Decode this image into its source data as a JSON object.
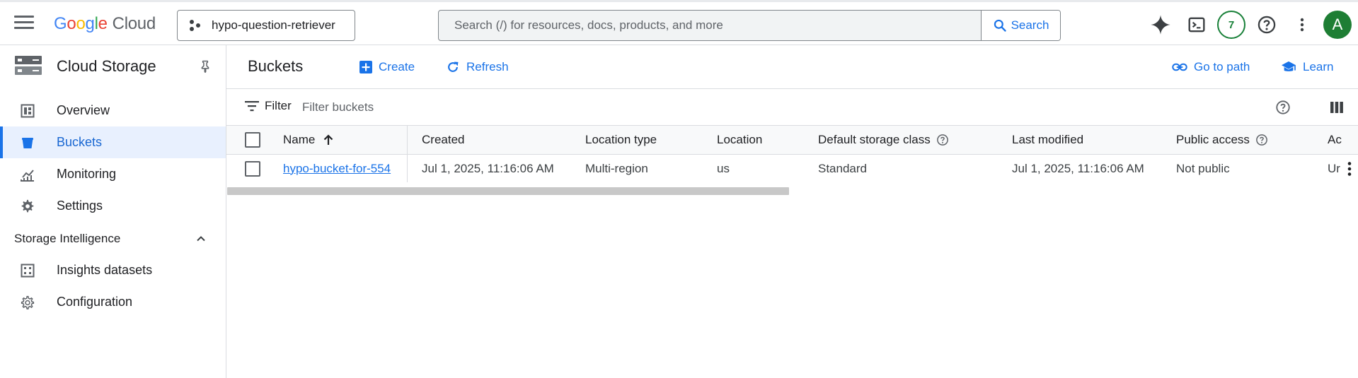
{
  "topbar": {
    "logo_letters": [
      "G",
      "o",
      "o",
      "g",
      "l",
      "e"
    ],
    "logo_product": "Cloud",
    "project_name": "hypo-question-retriever",
    "search_placeholder": "Search (/) for resources, docs, products, and more",
    "search_button": "Search",
    "notifications_count": "7",
    "avatar_initial": "A",
    "icons": [
      "menu-icon",
      "gemini-spark-icon",
      "cloud-shell-icon",
      "help-icon",
      "more-vert-icon"
    ]
  },
  "sidebar": {
    "product_title": "Cloud Storage",
    "items": [
      {
        "label": "Overview",
        "icon": "dashboard-icon",
        "active": false
      },
      {
        "label": "Buckets",
        "icon": "bucket-icon",
        "active": true
      },
      {
        "label": "Monitoring",
        "icon": "monitoring-icon",
        "active": false
      },
      {
        "label": "Settings",
        "icon": "gear-icon",
        "active": false
      }
    ],
    "section": {
      "label": "Storage Intelligence",
      "expanded": true,
      "items": [
        {
          "label": "Insights datasets",
          "icon": "dataset-icon"
        },
        {
          "label": "Configuration",
          "icon": "config-gear-icon"
        }
      ]
    }
  },
  "main": {
    "title": "Buckets",
    "actions": {
      "create": "Create",
      "refresh": "Refresh",
      "go_to_path": "Go to path",
      "learn": "Learn"
    },
    "filter": {
      "label": "Filter",
      "placeholder": "Filter buckets"
    },
    "table": {
      "columns": [
        "Name",
        "Created",
        "Location type",
        "Location",
        "Default storage class",
        "Last modified",
        "Public access",
        "Ac"
      ],
      "sort": {
        "column": "Name",
        "direction": "ascending"
      },
      "rows": [
        {
          "name": "hypo-bucket-for-554",
          "created": "Jul 1, 2025, 11:16:06 AM",
          "location_type": "Multi-region",
          "location": "us",
          "storage_class": "Standard",
          "last_modified": "Jul 1, 2025, 11:16:06 AM",
          "public_access": "Not public",
          "access_control": "Ur"
        }
      ]
    }
  },
  "colors": {
    "accent": "#1a73e8",
    "active_bg": "#e8f0fe",
    "badge_green": "#188038",
    "avatar_bg": "#1e7e34"
  }
}
